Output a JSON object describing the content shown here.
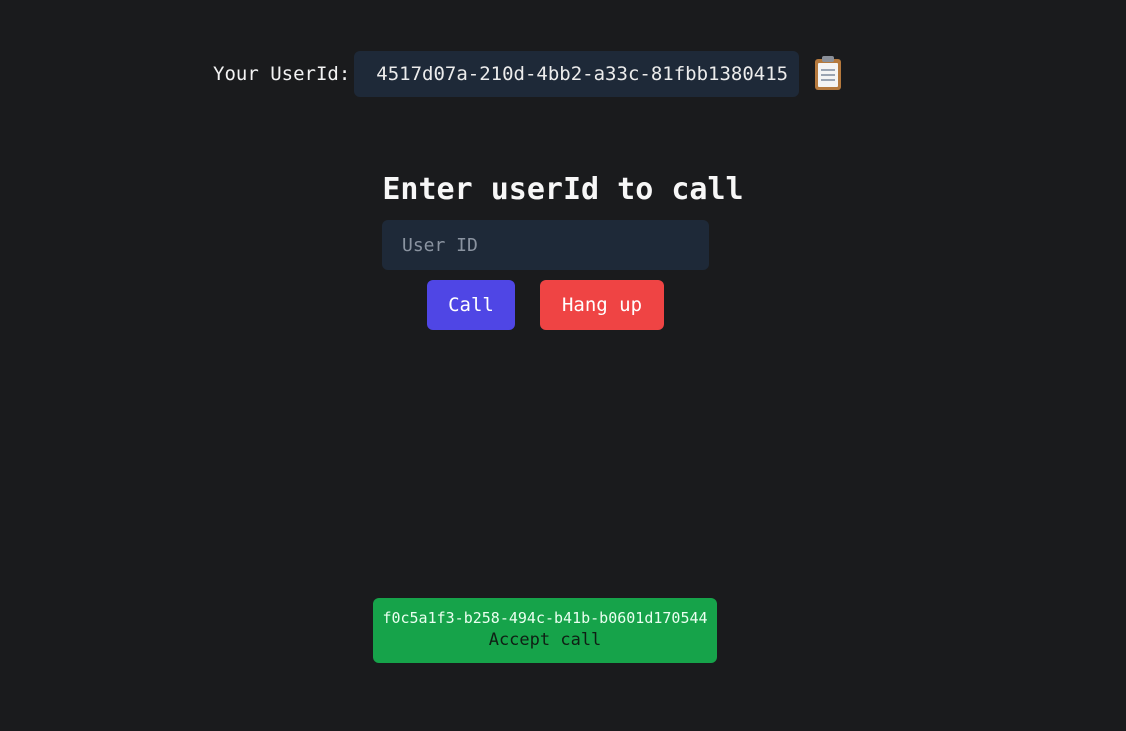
{
  "user": {
    "label": "Your UserId:",
    "id": "4517d07a-210d-4bb2-a33c-81fbb1380415",
    "copy_icon": "clipboard-icon"
  },
  "call_form": {
    "title": "Enter userId to call",
    "input_value": "",
    "input_placeholder": "User ID",
    "call_label": "Call",
    "hangup_label": "Hang up"
  },
  "incoming_call": {
    "caller_id": "f0c5a1f3-b258-494c-b41b-b0601d170544",
    "accept_label": "Accept call"
  },
  "colors": {
    "background": "#1a1b1d",
    "field": "#1e2938",
    "call": "#4f46e5",
    "hangup": "#ef4444",
    "accept": "#16a34a"
  }
}
